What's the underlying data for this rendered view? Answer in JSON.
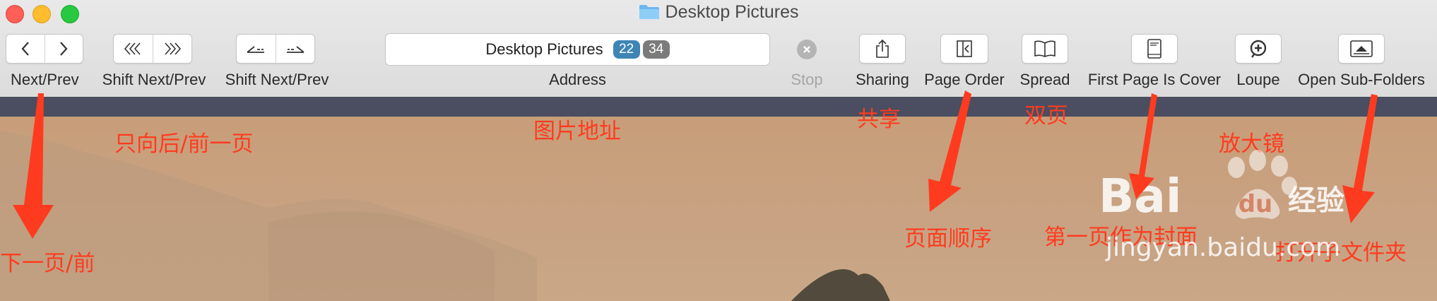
{
  "window": {
    "title": "Desktop Pictures",
    "folder_icon": "folder-icon"
  },
  "toolbar": {
    "next_prev_label": "Next/Prev",
    "shift_next_prev_label_1": "Shift Next/Prev",
    "shift_next_prev_label_2": "Shift Next/Prev",
    "address": {
      "label": "Address",
      "value": "Desktop Pictures",
      "badge_current": "22",
      "badge_total": "34",
      "badge_current_color": "#3e85b5",
      "badge_total_color": "#7b7b7b"
    },
    "stop_label": "Stop",
    "sharing_label": "Sharing",
    "page_order_label": "Page Order",
    "spread_label": "Spread",
    "first_page_cover_label": "First Page Is Cover",
    "loupe_label": "Loupe",
    "open_subfolders_label": "Open Sub-Folders"
  },
  "annotations": {
    "next_prev_cn": "下一页/前",
    "shift_cn": "只向后/前一页",
    "address_cn": "图片地址",
    "sharing_cn": "共享",
    "spread_cn": "双页",
    "page_order_cn": "页面顺序",
    "first_page_cn": "第一页作为封面",
    "loupe_cn": "放大镜",
    "subfolders_cn": "打开子文件夹",
    "color": "#ff3b1f"
  },
  "watermark": {
    "brand": "Bai du 经验",
    "url": "jingyan.baidu.com"
  }
}
